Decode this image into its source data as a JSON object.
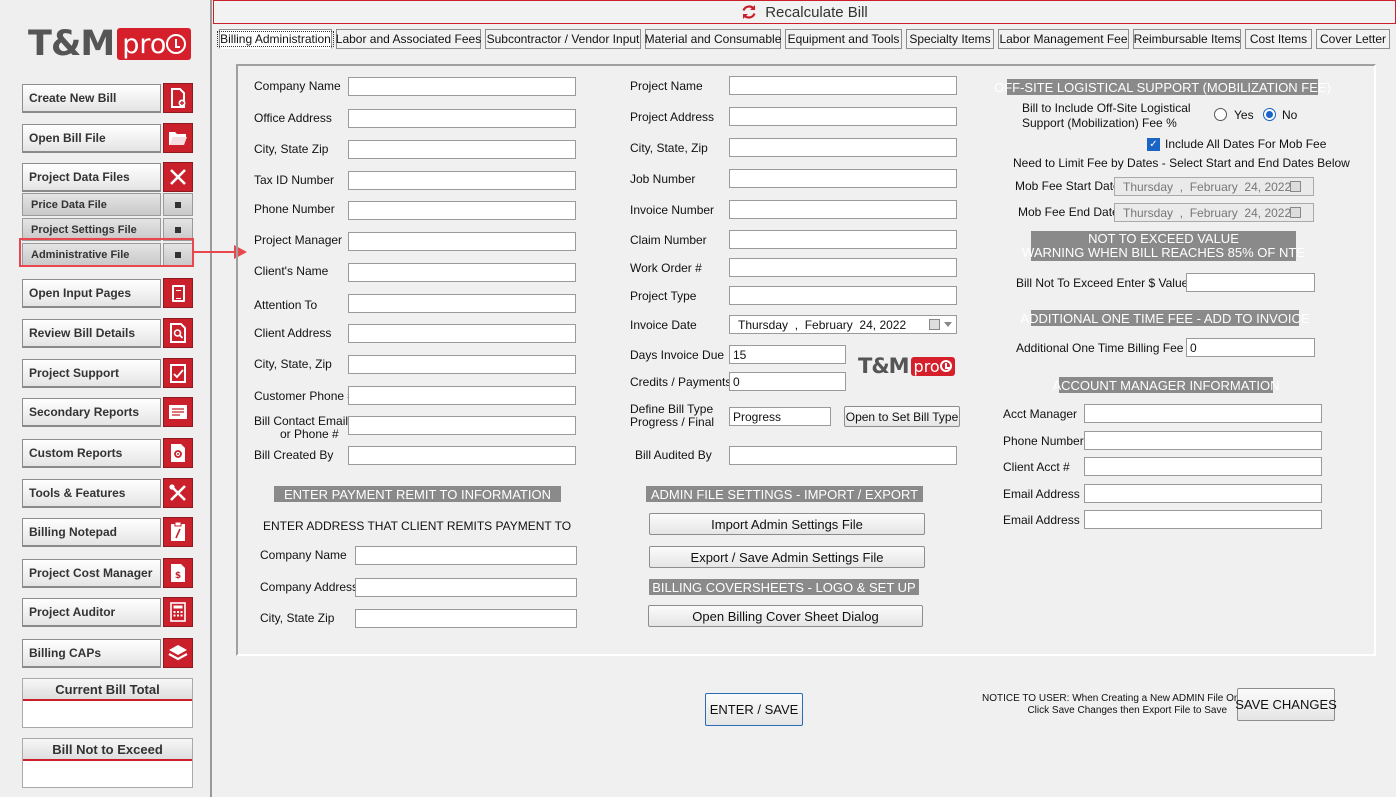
{
  "sidebar": {
    "logo": {
      "tm": "T&M",
      "pro": "pro"
    },
    "items": [
      {
        "label": "Create New Bill",
        "icon": "new-document-icon"
      },
      {
        "label": "Open Bill File",
        "icon": "folder-open-icon"
      },
      {
        "label": "Project Data Files",
        "icon": "close-x-icon"
      },
      {
        "label": "Open Input Pages",
        "icon": "document-icon"
      },
      {
        "label": "Review Bill Details",
        "icon": "magnify-document-icon"
      },
      {
        "label": "Project Support",
        "icon": "checklist-icon"
      },
      {
        "label": "Secondary Reports",
        "icon": "report-icon"
      },
      {
        "label": "Custom Reports",
        "icon": "gear-document-icon"
      },
      {
        "label": "Tools & Features",
        "icon": "tools-icon"
      },
      {
        "label": "Billing Notepad",
        "icon": "clipboard-icon"
      },
      {
        "label": "Project Cost Manager",
        "icon": "dollar-document-icon"
      },
      {
        "label": "Project Auditor",
        "icon": "calculator-icon"
      },
      {
        "label": "Billing CAPs",
        "icon": "layers-icon"
      }
    ],
    "sub_items": [
      {
        "label": "Price Data File"
      },
      {
        "label": "Project Settings File"
      },
      {
        "label": "Administrative File"
      }
    ],
    "current_bill_total": "Current Bill Total",
    "bill_not_to_exceed": "Bill Not to Exceed"
  },
  "recalc": {
    "label": "Recalculate Bill"
  },
  "tabs": [
    {
      "label": "Billing Administration"
    },
    {
      "label": "Labor and Associated Fees"
    },
    {
      "label": "Subcontractor / Vendor Input"
    },
    {
      "label": "Material and Consumable"
    },
    {
      "label": "Equipment and Tools"
    },
    {
      "label": "Specialty Items"
    },
    {
      "label": "Labor Management Fee"
    },
    {
      "label": "Reimbursable Items"
    },
    {
      "label": "Cost Items"
    },
    {
      "label": "Cover Letter"
    }
  ],
  "company": {
    "fields": [
      {
        "label": "Company Name",
        "value": ""
      },
      {
        "label": "Office Address",
        "value": ""
      },
      {
        "label": "City, State  Zip",
        "value": ""
      },
      {
        "label": "Tax ID Number",
        "value": ""
      },
      {
        "label": "Phone Number",
        "value": ""
      },
      {
        "label": "Project Manager",
        "value": ""
      },
      {
        "label": "Client's Name",
        "value": ""
      },
      {
        "label": "Attention To",
        "value": ""
      },
      {
        "label": "Client Address",
        "value": ""
      },
      {
        "label": "City, State, Zip",
        "value": ""
      },
      {
        "label": "Customer Phone #",
        "value": ""
      },
      {
        "label": "Bill Contact Email",
        "label2": "or Phone #",
        "value": ""
      },
      {
        "label": "Bill Created By",
        "value": ""
      }
    ]
  },
  "remit": {
    "header": "ENTER PAYMENT REMIT TO INFORMATION",
    "subheader": "ENTER ADDRESS THAT CLIENT REMITS PAYMENT TO",
    "fields": [
      {
        "label": "Company Name",
        "value": ""
      },
      {
        "label": "Company Address",
        "value": ""
      },
      {
        "label": "City, State  Zip",
        "value": ""
      }
    ]
  },
  "project": {
    "fields": [
      {
        "label": "Project Name",
        "value": ""
      },
      {
        "label": "Project Address",
        "value": ""
      },
      {
        "label": "City, State, Zip",
        "value": ""
      },
      {
        "label": "Job Number",
        "value": ""
      },
      {
        "label": "Invoice Number",
        "value": ""
      },
      {
        "label": "Claim Number",
        "value": ""
      },
      {
        "label": "Work Order #",
        "value": ""
      },
      {
        "label": "Project Type",
        "value": ""
      }
    ],
    "invoice_date": {
      "label": "Invoice Date",
      "weekday": "Thursday",
      "sep": ",",
      "month": "February",
      "day_year": "24, 2022"
    },
    "days_due": {
      "label": "Days Invoice Due",
      "value": "15"
    },
    "credits": {
      "label": "Credits / Payments",
      "value": "0"
    },
    "bill_type": {
      "label": "Define Bill Type",
      "label2": "Progress / Final",
      "value": "Progress",
      "button": "Open to Set Bill Type"
    },
    "audited_by": {
      "label": "Bill Audited By",
      "value": ""
    },
    "logo": {
      "tm": "T&M",
      "pro": "pro"
    }
  },
  "admin_settings": {
    "header": "ADMIN FILE SETTINGS - IMPORT / EXPORT",
    "import_button": "Import Admin Settings File",
    "export_button": "Export / Save Admin Settings File"
  },
  "coversheets": {
    "header": "BILLING COVERSHEETS - LOGO & SET UP",
    "button": "Open Billing Cover Sheet Dialog"
  },
  "mobilization": {
    "header": "OFF-SITE LOGISTICAL SUPPORT (MOBILIZATION FEE)",
    "question_line1": "Bill to Include Off-Site Logistical",
    "question_line2": "Support (Mobilization) Fee %",
    "yes_label": "Yes",
    "no_label": "No",
    "selected": "No",
    "include_all_dates": "Include All Dates For Mob Fee",
    "include_all_dates_checked": true,
    "limit_note": "Need to Limit Fee by Dates - Select Start and End Dates Below",
    "start": {
      "label": "Mob Fee Start Date",
      "weekday": "Thursday",
      "sep": ",",
      "month": "February",
      "day_year": "24, 2022"
    },
    "end": {
      "label": "Mob Fee End Date",
      "weekday": "Thursday",
      "sep": ",",
      "month": "February",
      "day_year": "24, 2022"
    }
  },
  "nte": {
    "header_line1": "NOT TO EXCEED VALUE",
    "header_line2": "WARNING WHEN BILL REACHES 85% OF NTE",
    "label": "Bill Not To Exceed Enter $ Value",
    "value": ""
  },
  "one_time_fee": {
    "header": "ADDITIONAL ONE TIME FEE - ADD TO INVOICE",
    "label": "Additional One Time Billing Fee",
    "value": "0"
  },
  "account_manager": {
    "header": "ACCOUNT MANAGER INFORMATION",
    "fields": [
      {
        "label": "Acct Manager",
        "value": ""
      },
      {
        "label": "Phone Number",
        "value": ""
      },
      {
        "label": "Client Acct #",
        "value": ""
      },
      {
        "label": "Email Address",
        "value": ""
      },
      {
        "label": "Email Address",
        "value": ""
      }
    ]
  },
  "footer": {
    "enter_save": "ENTER / SAVE",
    "notice_line1": "NOTICE TO USER: When Creating a New ADMIN File Only",
    "notice_line2": "Click Save Changes then Export File to Save",
    "save_changes": "SAVE CHANGES"
  },
  "colors": {
    "brand_red": "#c9202b",
    "highlight": "#e8474e",
    "accent_blue": "#1a64c6"
  }
}
